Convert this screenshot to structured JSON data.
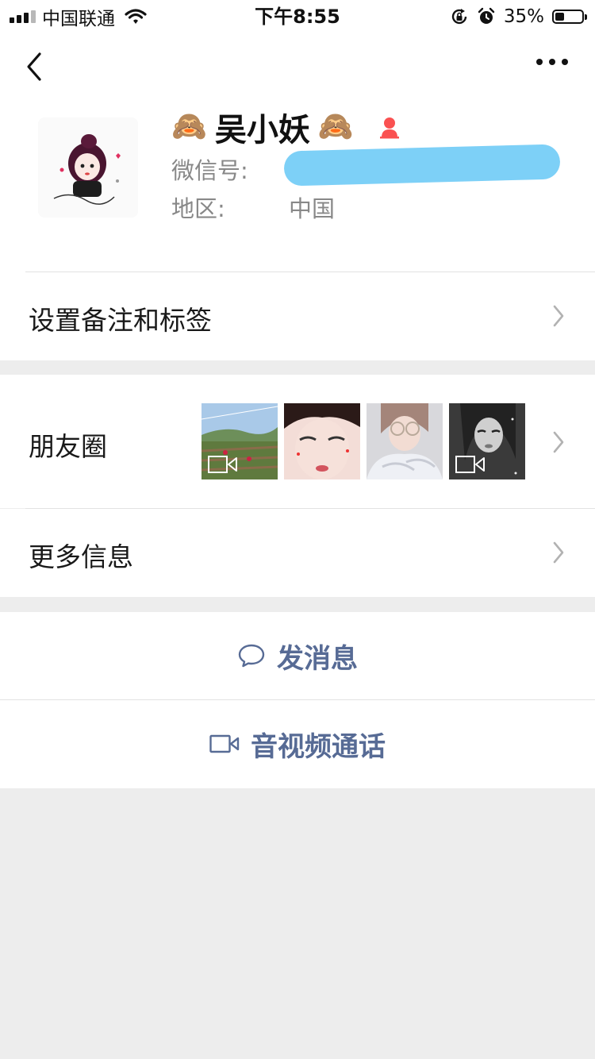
{
  "status_bar": {
    "carrier": "中国联通",
    "time": "下午8:55",
    "battery_percent_text": "35%",
    "battery_level": 0.35
  },
  "nav": {
    "back_icon": "chevron-left-icon",
    "more_icon": "more-dots-icon"
  },
  "profile": {
    "emoji_left": "🙈",
    "nickname": "吴小妖",
    "emoji_right": "🙈",
    "gender_icon": "female-icon",
    "wechat_id_label": "微信号:",
    "region_label": "地区:",
    "region_value": "中国",
    "colors": {
      "redaction": "#7dd0f7",
      "female": "#fa5151"
    }
  },
  "cells": {
    "remark_tags": "设置备注和标签",
    "moments": "朋友圈",
    "more_info": "更多信息"
  },
  "moments_thumbs": [
    {
      "name": "landscape",
      "video": true
    },
    {
      "name": "selfie",
      "video": false
    },
    {
      "name": "portrait-sunglasses",
      "video": false
    },
    {
      "name": "portrait-mono",
      "video": true
    }
  ],
  "actions": {
    "send_message": "发消息",
    "av_call": "音视频通话",
    "link_color": "#576b95"
  }
}
